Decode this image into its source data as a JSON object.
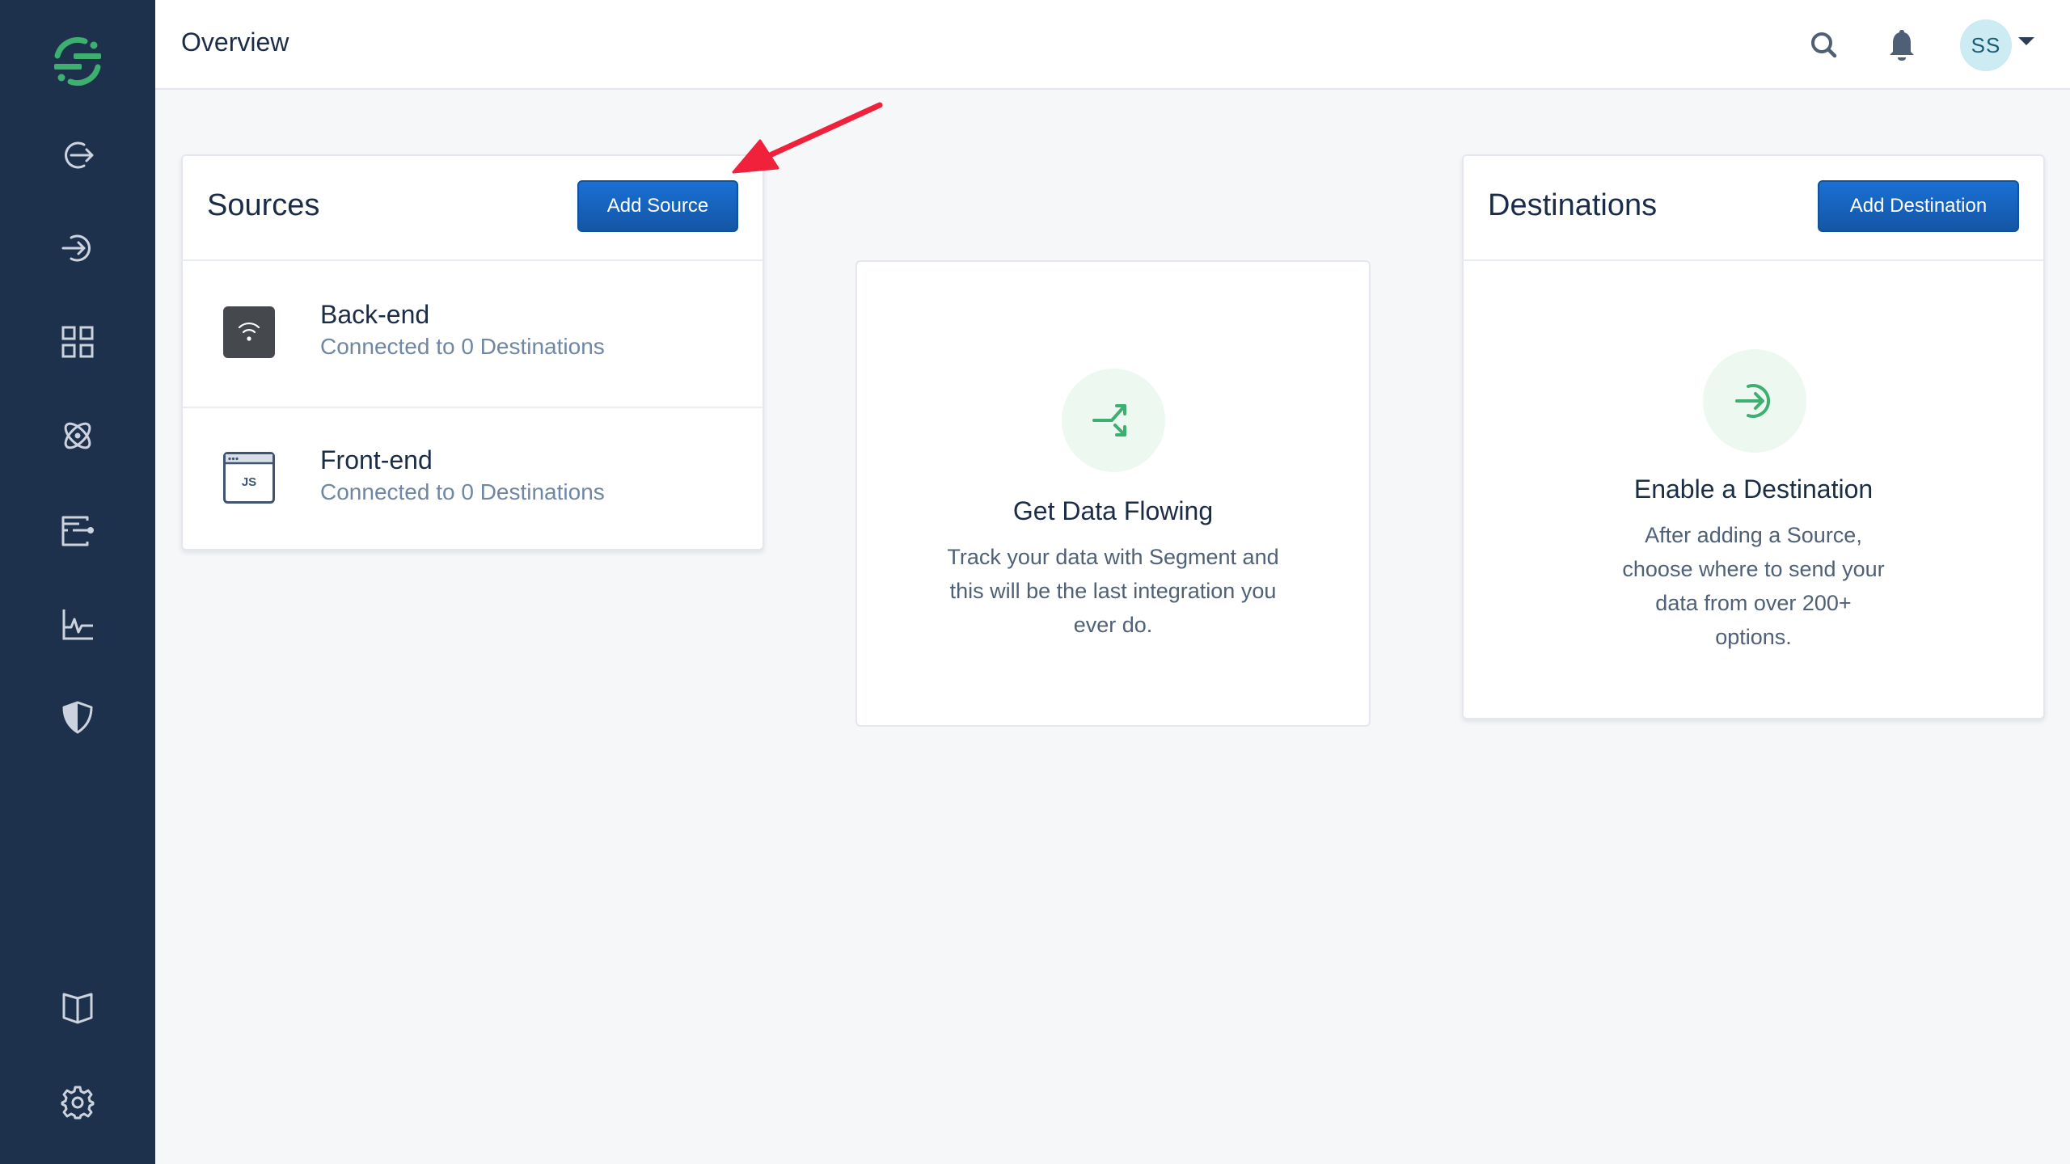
{
  "sidebar": {
    "logo": "segment-logo",
    "items": [
      {
        "name": "sources",
        "icon": "exit-arrow-icon"
      },
      {
        "name": "destinations",
        "icon": "enter-arrow-icon"
      },
      {
        "name": "catalog",
        "icon": "grid-icon"
      },
      {
        "name": "personas",
        "icon": "atom-icon"
      },
      {
        "name": "protocols",
        "icon": "schema-icon"
      },
      {
        "name": "monitoring",
        "icon": "activity-chart-icon"
      },
      {
        "name": "privacy",
        "icon": "shield-icon"
      }
    ],
    "bottom_items": [
      {
        "name": "docs",
        "icon": "book-icon"
      },
      {
        "name": "settings",
        "icon": "gear-icon"
      }
    ]
  },
  "header": {
    "title": "Overview",
    "avatar_initials": "SS"
  },
  "sources": {
    "title": "Sources",
    "add_button": "Add Source",
    "items": [
      {
        "name": "Back-end",
        "status": "Connected to 0 Destinations",
        "icon": "server-wifi-icon"
      },
      {
        "name": "Front-end",
        "status": "Connected to 0 Destinations",
        "icon": "javascript-window-icon",
        "icon_label": "JS"
      }
    ]
  },
  "flow": {
    "title": "Get Data Flowing",
    "lines": [
      "Track your data with Segment and",
      "this will be the last integration you",
      "ever do."
    ]
  },
  "destinations": {
    "title": "Destinations",
    "add_button": "Add Destination",
    "empty_title": "Enable a Destination",
    "lines": [
      "After adding a Source,",
      "choose where to send your",
      "data from over 200+",
      "options."
    ]
  },
  "colors": {
    "sidebar": "#1d314d",
    "brand_green": "#3daf6f",
    "primary_button": "#1565c0",
    "annotation_arrow": "#f0213b"
  }
}
